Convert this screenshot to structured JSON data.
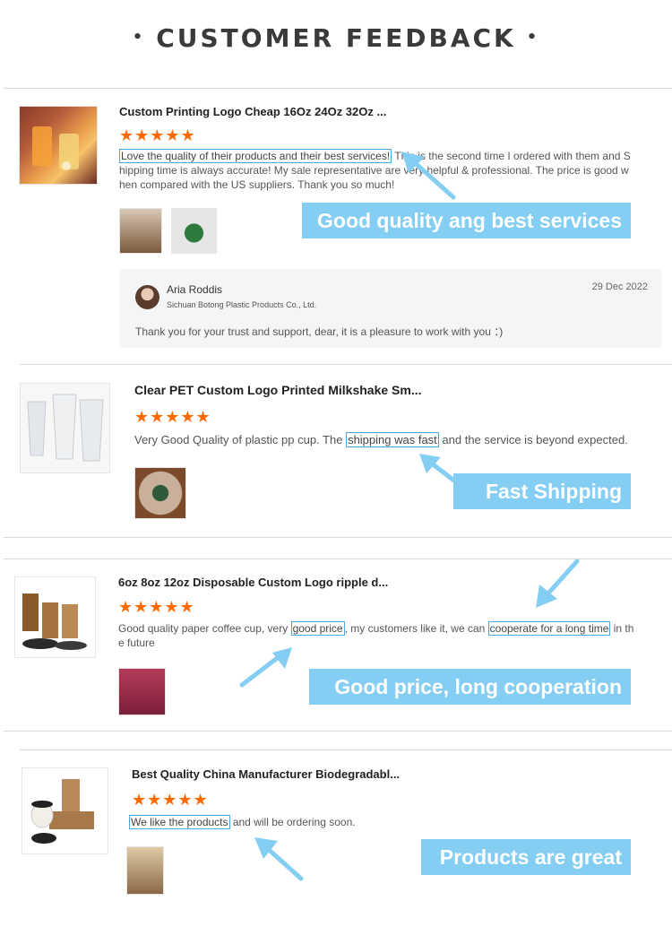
{
  "heading": {
    "text": "CUSTOMER FEEDBACK",
    "bullet": "•"
  },
  "star_glyph": "★★★★★",
  "colors": {
    "star": "#ff6a00",
    "callout_bg": "#84cdf3",
    "highlight": "#4aa8e8",
    "arrow": "#84cdf3"
  },
  "reviews": [
    {
      "product_title": "Custom Printing Logo Cheap 16Oz 24Oz 32Oz ...",
      "rating": 5,
      "text_lines": [
        {
          "pre": "",
          "hl": "Love the quality of their products and their best services!",
          "post": " This is the second time I ordered with them and S"
        },
        {
          "pre": "hipping time is always accurate! My sale representative are very helpful & professional. The price is good w",
          "hl": "",
          "post": ""
        },
        {
          "pre": "hen compared with the US suppliers. Thank you so much!",
          "hl": "",
          "post": ""
        }
      ],
      "callout": "Good quality ang best services",
      "reply": {
        "name": "Aria Roddis",
        "company": "Sichuan Botong Plastic Products Co., Ltd.",
        "date": "29 Dec 2022",
        "message": "Thank you for your trust and support, dear, it is a pleasure to work with you ：)"
      }
    },
    {
      "product_title": "Clear PET Custom Logo Printed Milkshake Sm...",
      "rating": 5,
      "text_pre": "Very Good Quality of plastic pp cup. The ",
      "text_hl": "shipping was fast",
      "text_post": " and the service is beyond expected.",
      "callout": "Fast Shipping"
    },
    {
      "product_title": "6oz 8oz 12oz Disposable Custom Logo ripple d...",
      "rating": 5,
      "line1_a": "Good quality paper coffee cup, very ",
      "line1_hl1": "good price",
      "line1_b": ", my customers like it, we can ",
      "line1_hl2": "cooperate for a long time",
      "line1_c": " in th",
      "line2": "e future",
      "callout": "Good price, long cooperation"
    },
    {
      "product_title": "Best Quality China Manufacturer Biodegradabl...",
      "rating": 5,
      "text_hl": "We like the products",
      "text_post": " and will be ordering soon.",
      "callout": "Products are great"
    }
  ]
}
